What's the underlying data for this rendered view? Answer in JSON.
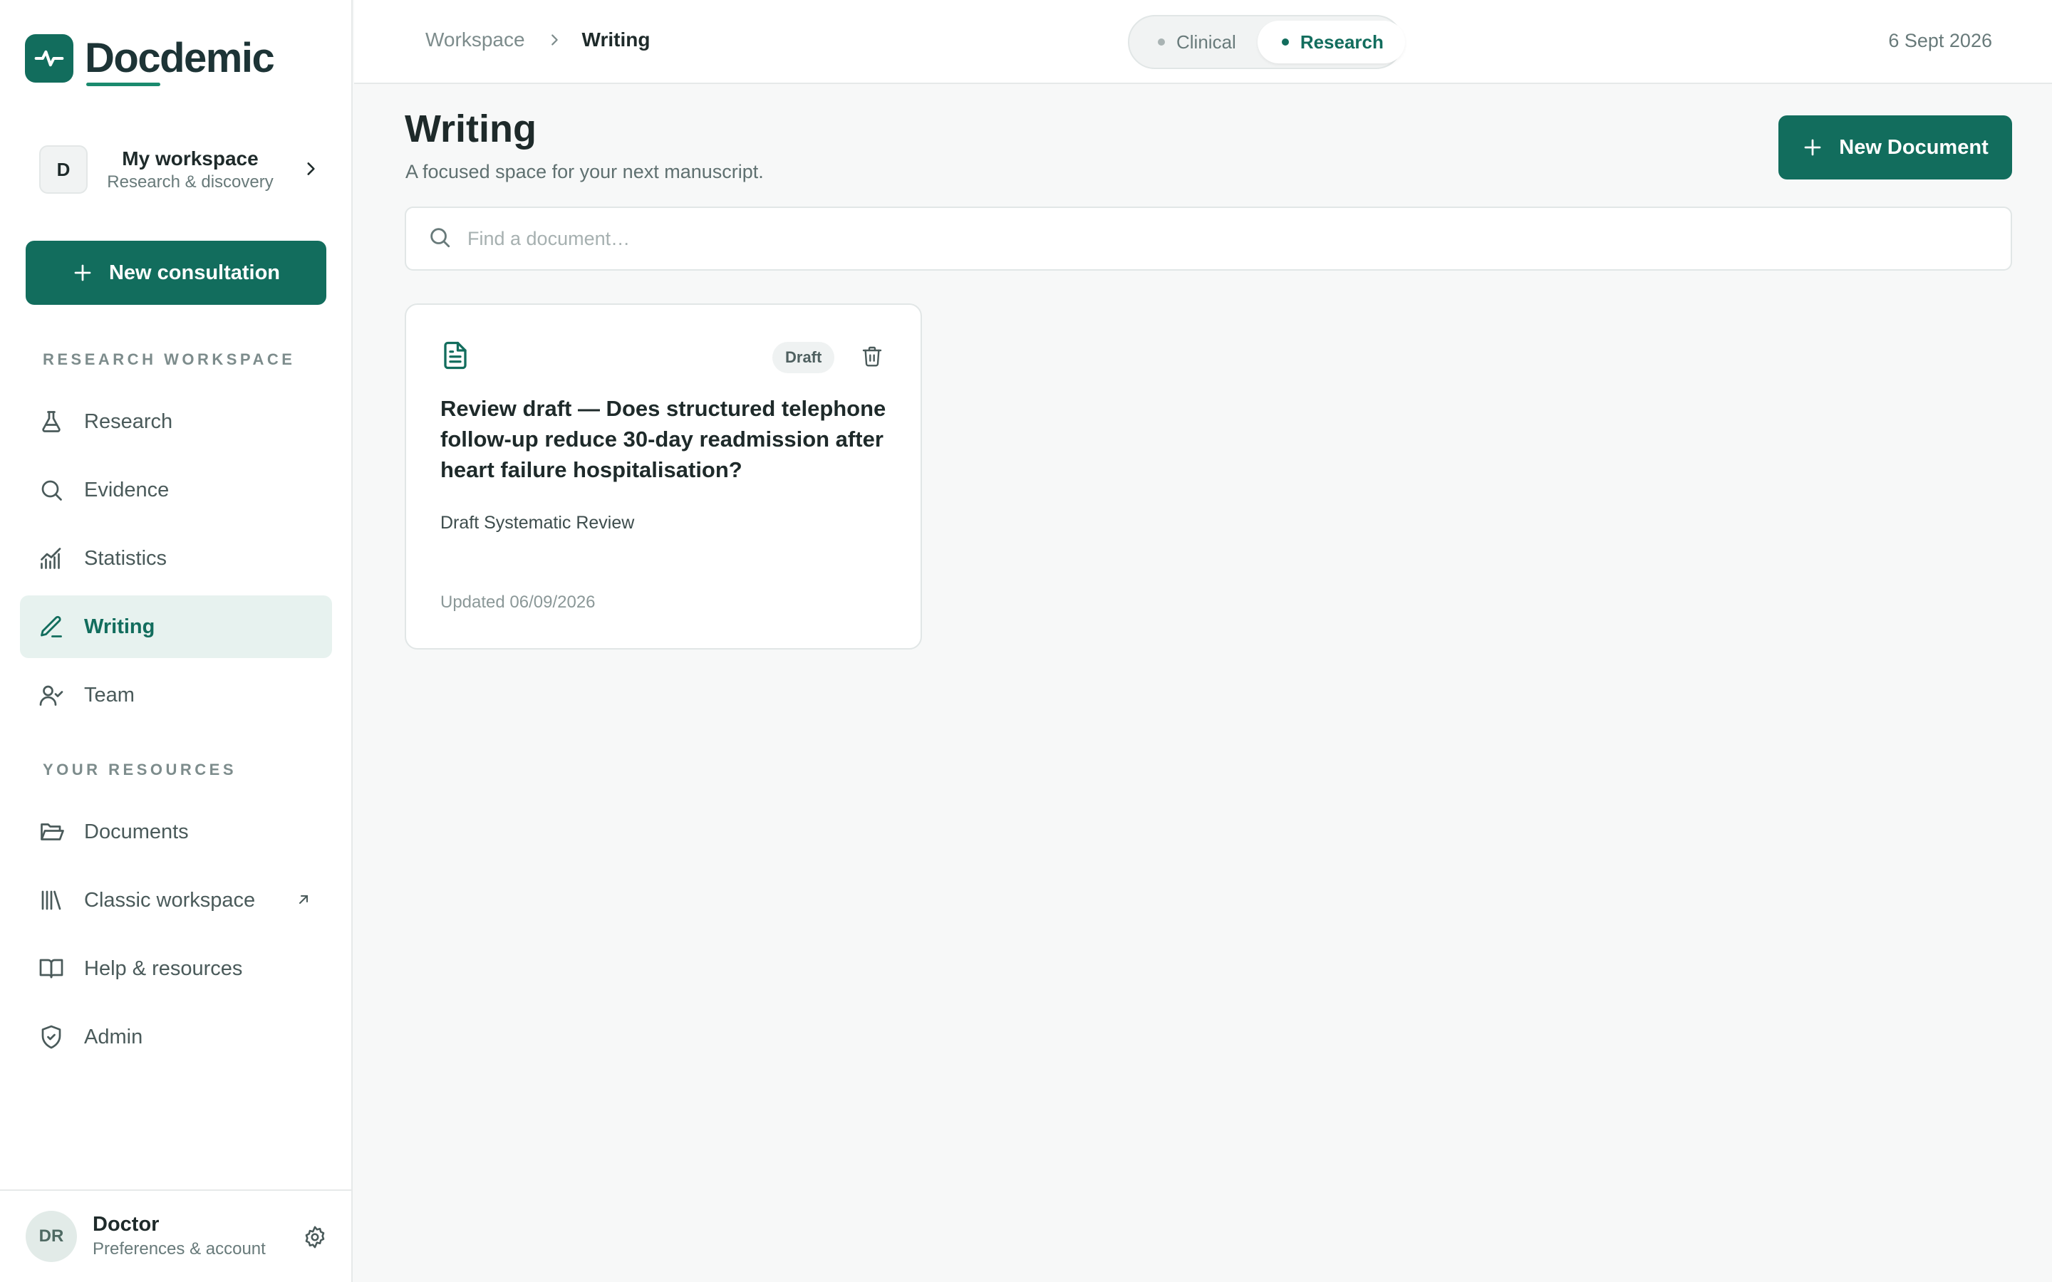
{
  "brand": {
    "name": "Docdemic",
    "accent": "#126d5d"
  },
  "workspace": {
    "initial": "D",
    "name": "My workspace",
    "subtitle": "Research & discovery"
  },
  "sidebar": {
    "new_consultation_label": "New consultation",
    "sections": [
      {
        "label": "RESEARCH WORKSPACE",
        "items": [
          {
            "label": "Research",
            "icon": "flask-icon"
          },
          {
            "label": "Evidence",
            "icon": "search-icon"
          },
          {
            "label": "Statistics",
            "icon": "chart-icon"
          },
          {
            "label": "Writing",
            "icon": "pen-icon",
            "active": true
          },
          {
            "label": "Team",
            "icon": "user-check-icon"
          }
        ]
      },
      {
        "label": "YOUR RESOURCES",
        "items": [
          {
            "label": "Documents",
            "icon": "folder-icon"
          },
          {
            "label": "Classic workspace",
            "icon": "library-icon",
            "external": true
          },
          {
            "label": "Help & resources",
            "icon": "book-icon"
          },
          {
            "label": "Admin",
            "icon": "shield-icon"
          }
        ]
      }
    ]
  },
  "user": {
    "initials": "DR",
    "name": "Doctor",
    "subtitle": "Preferences & account"
  },
  "topbar": {
    "breadcrumb": {
      "root": "Workspace",
      "current": "Writing"
    },
    "modes": [
      {
        "label": "Clinical",
        "active": false
      },
      {
        "label": "Research",
        "active": true
      }
    ],
    "date": "6 Sept 2026"
  },
  "main": {
    "title": "Writing",
    "subtitle": "A focused space for your next manuscript.",
    "new_document_label": "New Document",
    "search": {
      "placeholder": "Find a document…",
      "value": ""
    },
    "documents": [
      {
        "badge": "Draft",
        "title": "Review draft — Does structured telephone follow-up reduce 30-day readmission after heart failure hospitalisation?",
        "type": "Draft Systematic Review",
        "updated": "Updated 06/09/2026"
      }
    ]
  }
}
